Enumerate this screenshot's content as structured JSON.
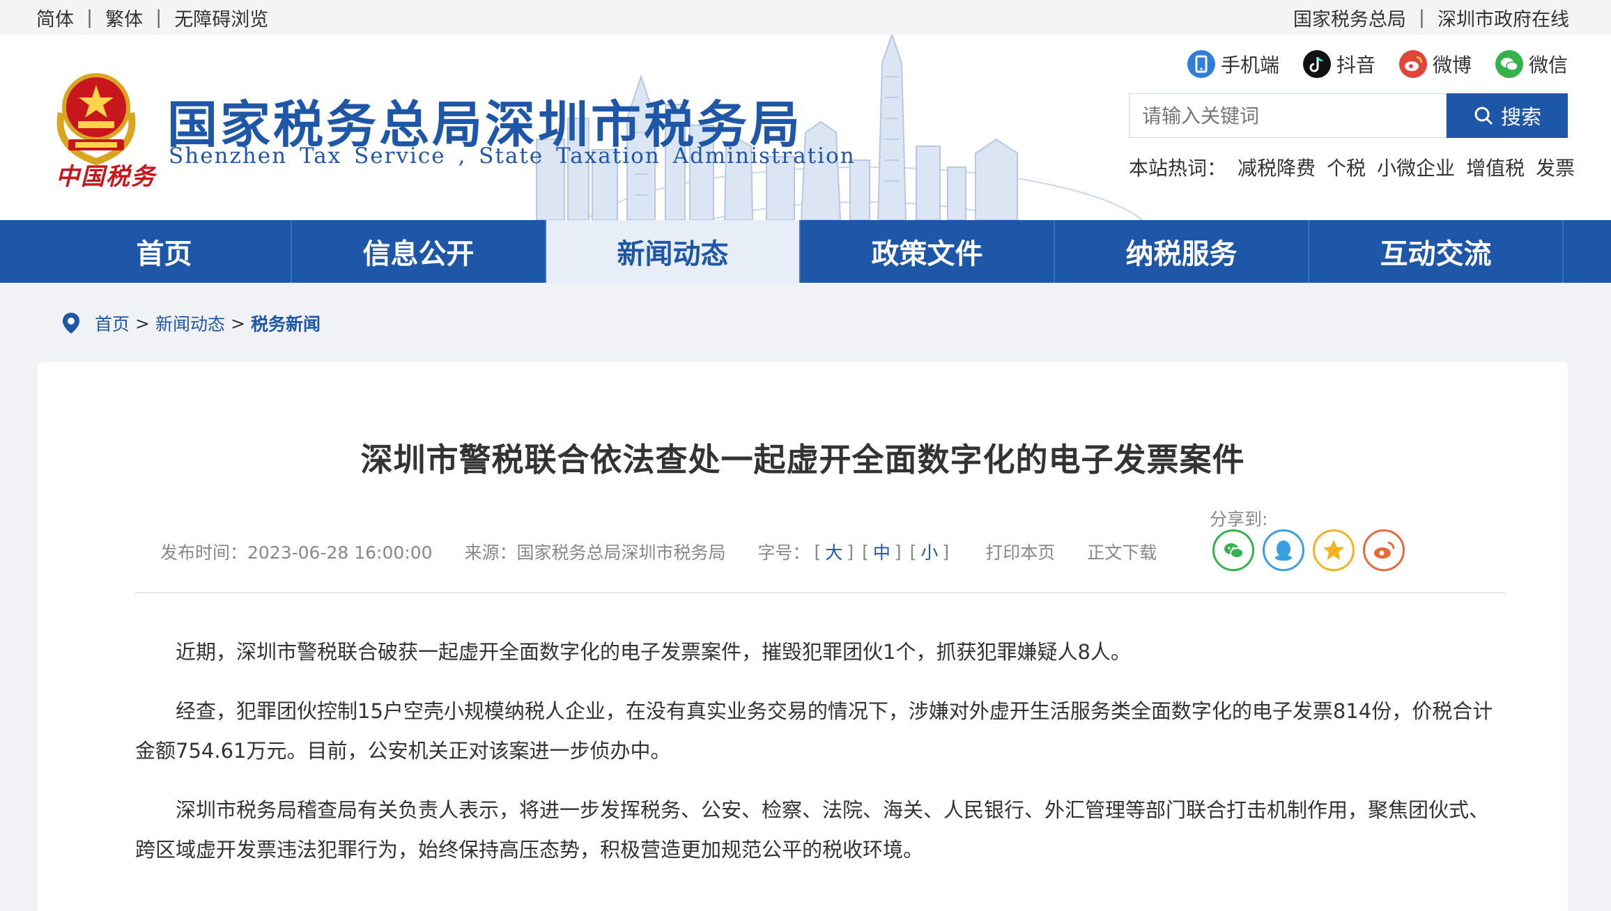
{
  "utility": {
    "left": [
      "简体",
      "繁体",
      "无障碍浏览"
    ],
    "right": [
      "国家税务总局",
      "深圳市政府在线"
    ],
    "separator": "|"
  },
  "header": {
    "emblem_text": "中国税务",
    "title": "国家税务总局深圳市税务局",
    "subtitle": "Shenzhen Tax Service , State Taxation Administration",
    "social": [
      {
        "label": "手机端",
        "icon": "mobile-icon",
        "color": "#2f7fd8"
      },
      {
        "label": "抖音",
        "icon": "douyin-icon",
        "color": "#111111"
      },
      {
        "label": "微博",
        "icon": "weibo-icon",
        "color": "#e0453b"
      },
      {
        "label": "微信",
        "icon": "wechat-icon",
        "color": "#36b24a"
      }
    ],
    "search": {
      "placeholder": "请输入关键词",
      "button": "搜索"
    },
    "hotwords_label": "本站热词：",
    "hotwords": [
      "减税降费",
      "个税",
      "小微企业",
      "增值税",
      "发票"
    ]
  },
  "nav": {
    "items": [
      "首页",
      "信息公开",
      "新闻动态",
      "政策文件",
      "纳税服务",
      "互动交流"
    ],
    "active_index": 2
  },
  "breadcrumb": {
    "items": [
      "首页",
      "新闻动态",
      "税务新闻"
    ],
    "separator": ">"
  },
  "article": {
    "title": "深圳市警税联合依法查处一起虚开全面数字化的电子发票案件",
    "share_label": "分享到:",
    "meta": {
      "publish_time": "发布时间：2023-06-28 16:00:00",
      "source": "来源：国家税务总局深圳市税务局",
      "font_label": "字号：",
      "font_sizes": [
        "大",
        "中",
        "小"
      ],
      "print": "打印本页",
      "download": "正文下载"
    },
    "share_icons": [
      {
        "name": "wechat-share-icon",
        "color": "#36b24a"
      },
      {
        "name": "qq-share-icon",
        "color": "#3a9fe0"
      },
      {
        "name": "qzone-share-icon",
        "color": "#f2b423"
      },
      {
        "name": "weibo-share-icon",
        "color": "#e66a3c"
      }
    ],
    "paragraphs": [
      "近期，深圳市警税联合破获一起虚开全面数字化的电子发票案件，摧毁犯罪团伙1个，抓获犯罪嫌疑人8人。",
      "经查，犯罪团伙控制15户空壳小规模纳税人企业，在没有真实业务交易的情况下，涉嫌对外虚开生活服务类全面数字化的电子发票814份，价税合计金额754.61万元。目前，公安机关正对该案进一步侦办中。",
      "深圳市税务局稽查局有关负责人表示，将进一步发挥税务、公安、检察、法院、海关、人民银行、外汇管理等部门联合打击机制作用，聚焦团伙式、跨区域虚开发票违法犯罪行为，始终保持高压态势，积极营造更加规范公平的税收环境。"
    ]
  },
  "colors": {
    "brand_blue": "#1e56a8",
    "nav_active_bg": "#e8eef8",
    "emblem_red": "#c8161d",
    "emblem_gold": "#d9a520"
  }
}
